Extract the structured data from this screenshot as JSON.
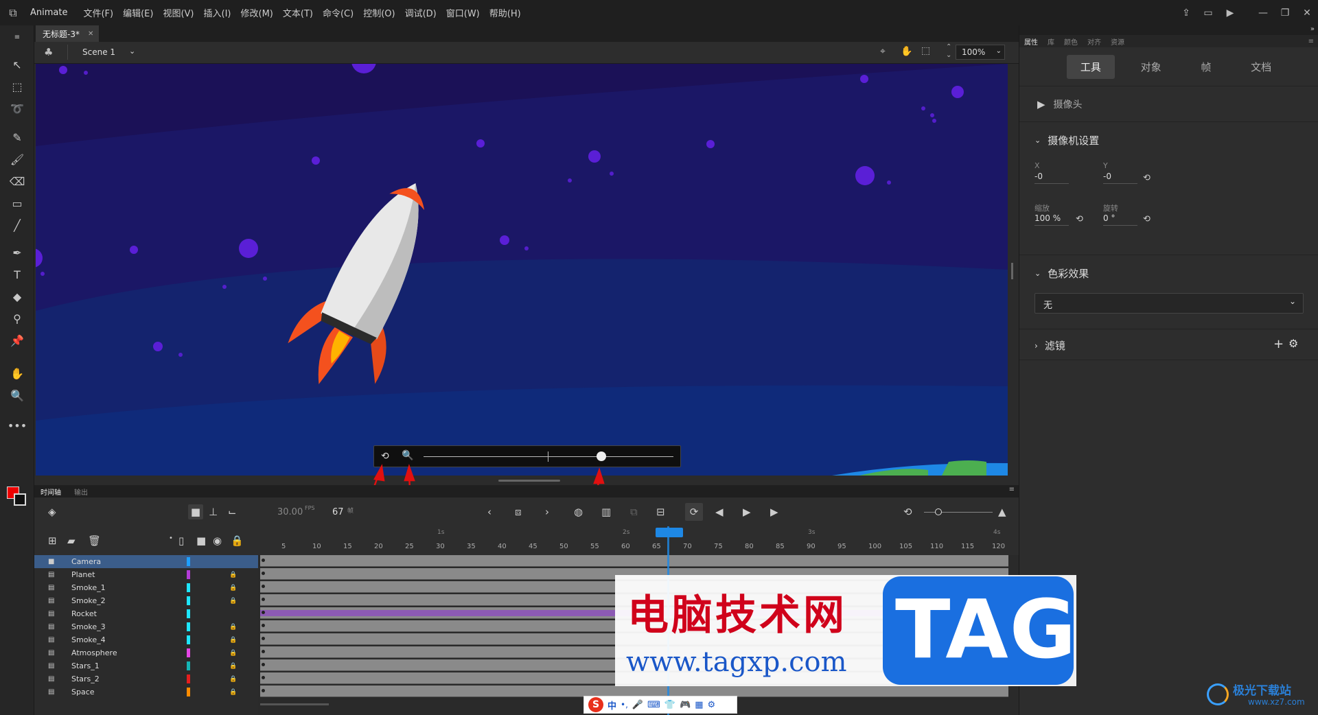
{
  "menubar": {
    "app_name": "Animate",
    "menus": [
      "文件(F)",
      "编辑(E)",
      "视图(V)",
      "插入(I)",
      "修改(M)",
      "文本(T)",
      "命令(C)",
      "控制(O)",
      "调试(D)",
      "窗口(W)",
      "帮助(H)"
    ]
  },
  "document": {
    "tab_title": "无标题-3*",
    "scene": "Scene 1",
    "zoom": "100%"
  },
  "properties": {
    "panel_tabs": [
      "属性",
      "库",
      "颜色",
      "对齐",
      "资源"
    ],
    "subtabs": [
      "工具",
      "对象",
      "帧",
      "文档"
    ],
    "tool_name": "摄像头",
    "camera_section": "摄像机设置",
    "x_label": "X",
    "y_label": "Y",
    "x_value": "-0",
    "y_value": "-0",
    "zoom_label": "缩放",
    "zoom_value": "100 %",
    "rotate_label": "旋转",
    "rotate_value": "0 °",
    "color_section": "色彩效果",
    "color_effect": "无",
    "filter_section": "滤镜"
  },
  "timeline": {
    "tabs": [
      "时间轴",
      "输出"
    ],
    "fps": "30.00",
    "fps_unit": "FPS",
    "frame": "67",
    "frame_unit": "帧",
    "ruler_numbers": [
      "5",
      "10",
      "15",
      "20",
      "25",
      "30",
      "35",
      "40",
      "45",
      "50",
      "55",
      "60",
      "65",
      "70",
      "75",
      "80",
      "85",
      "90",
      "95",
      "100",
      "105",
      "110",
      "115",
      "120"
    ],
    "seconds": [
      "1s",
      "2s",
      "3s",
      "4s"
    ],
    "layers": [
      {
        "name": "Camera",
        "color": "#1ea0ff"
      },
      {
        "name": "Planet",
        "color": "#b43cd8"
      },
      {
        "name": "Smoke_1",
        "color": "#1ee6ff"
      },
      {
        "name": "Smoke_2",
        "color": "#1ee6ff"
      },
      {
        "name": "Rocket",
        "color": "#1ee6ff"
      },
      {
        "name": "Smoke_3",
        "color": "#1ee6ff"
      },
      {
        "name": "Smoke_4",
        "color": "#1ee6ff"
      },
      {
        "name": "Atmosphere",
        "color": "#e646e6"
      },
      {
        "name": "Stars_1",
        "color": "#14b4b4"
      },
      {
        "name": "Stars_2",
        "color": "#e61e1e"
      },
      {
        "name": "Space",
        "color": "#ff8c00"
      }
    ]
  },
  "watermark": {
    "title": "电脑技术网",
    "url": "www.tagxp.com",
    "logo": "TAG",
    "corner": "极光下载站",
    "corner_url": "www.xz7.com"
  },
  "ime": {
    "label": "中"
  }
}
